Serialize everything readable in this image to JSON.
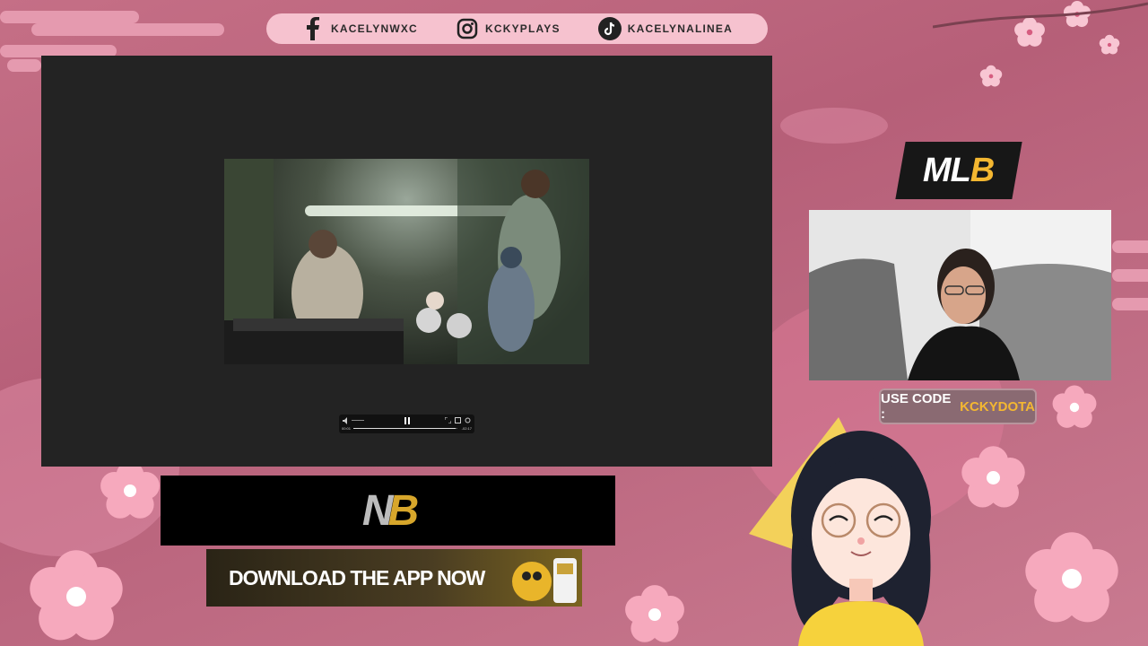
{
  "social": [
    {
      "platform": "facebook",
      "handle": "KACELYNWXC",
      "icon": "facebook-icon"
    },
    {
      "platform": "instagram",
      "handle": "KCKYPLAYS",
      "icon": "instagram-icon"
    },
    {
      "platform": "tiktok",
      "handle": "KACELYNALINEA",
      "icon": "tiktok-icon"
    }
  ],
  "player": {
    "time_current": "00:01",
    "time_remaining": "-02:17",
    "progress": 0.98
  },
  "mlb": {
    "logo_main": "ML",
    "logo_accent": "B"
  },
  "promo": {
    "label": "USE CODE :",
    "code": "KCKYDOTA"
  },
  "sponsor": {
    "logo_main": "N",
    "logo_accent": "B",
    "download_text": "DOWNLOAD THE APP NOW"
  },
  "colors": {
    "background": "#c56f86",
    "accent_gold": "#f4b731",
    "bar_pink": "#f6c2cf",
    "panel_dark": "#232323"
  }
}
